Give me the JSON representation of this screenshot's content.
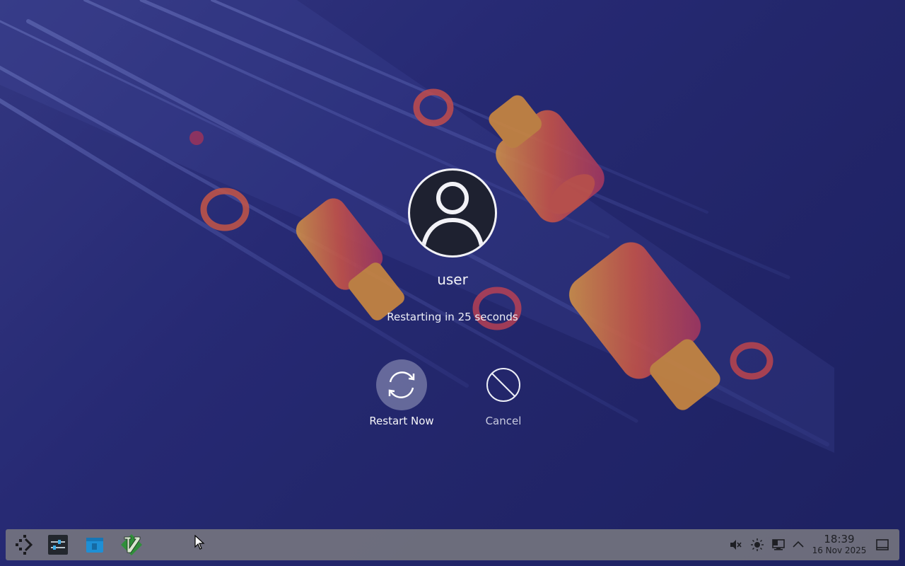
{
  "session": {
    "username": "user",
    "countdown_text": "Restarting in 25 seconds"
  },
  "actions": {
    "restart_label": "Restart Now",
    "cancel_label": "Cancel"
  },
  "taskbar": {
    "launcher_icon": "kde-launcher-icon",
    "apps": [
      {
        "name": "system-settings-icon"
      },
      {
        "name": "file-manager-icon"
      },
      {
        "name": "vim-icon"
      }
    ],
    "tray": [
      {
        "name": "volume-muted-icon"
      },
      {
        "name": "brightness-icon"
      },
      {
        "name": "network-icon"
      },
      {
        "name": "show-hidden-icons-icon"
      }
    ],
    "clock": {
      "time": "18:39",
      "date": "16 Nov 2025"
    },
    "show_desktop_icon": "show-desktop-icon"
  },
  "colors": {
    "background": "#2b2f7e",
    "accent_orange": "#f0a040",
    "accent_red": "#e85a4a",
    "taskbar": "#78787f"
  }
}
